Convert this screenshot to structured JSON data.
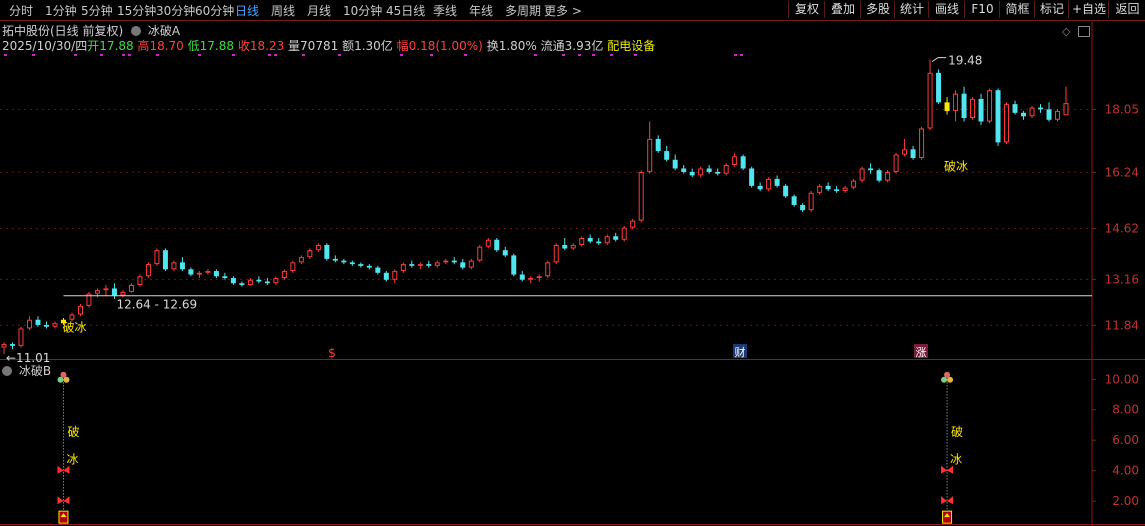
{
  "toolbar": {
    "timeframes": [
      "分时",
      "1分钟",
      "5分钟",
      "15分钟",
      "30分钟",
      "60分钟",
      "日线",
      "周线",
      "月线",
      "10分钟",
      "45日线",
      "季线",
      "年线",
      "多周期",
      "更多 >"
    ],
    "active": "日线",
    "right_buttons": [
      "复权",
      "叠加",
      "多股",
      "统计",
      "画线",
      "F10",
      "简框",
      "标记",
      "+自选",
      "返回"
    ]
  },
  "stock": {
    "name_line": "拓中股份(日线 前复权)",
    "indicator_main": "冰破A",
    "date": "2025/10/30/四",
    "open_label": "开",
    "open": "17.88",
    "high_label": "高",
    "high": "18.70",
    "low_label": "低",
    "low": "17.88",
    "close_label": "收",
    "close": "18.23",
    "vol_label": "量",
    "vol": "70781",
    "amt_label": "额",
    "amt": "1.30亿",
    "chg_label": "幅",
    "chg": "0.18(1.00%)",
    "turnover_label": "换",
    "turnover": "1.80%",
    "float_label": "流通",
    "float": "3.93亿",
    "sector": "配电设备"
  },
  "main_chart": {
    "y_ticks": [
      "18.05",
      "16.24",
      "14.62",
      "13.16",
      "11.84"
    ],
    "annotations": {
      "max_label": "19.48",
      "min_label": "11.01",
      "support_label": "12.64 - 12.69",
      "signal_text_1": "破冰",
      "signal_text_2": "破冰"
    },
    "markers": {
      "s": "$",
      "cai": "财",
      "zhang": "涨"
    },
    "colors": {
      "up": "#ff3a3a",
      "down": "#50e6f0",
      "signal": "#ffe800",
      "dots": "#d020d0"
    }
  },
  "sub_chart": {
    "title": "冰破B",
    "y_ticks": [
      "10.00",
      "8.00",
      "6.00",
      "4.00",
      "2.00"
    ],
    "text_po": "破",
    "text_bing": "冰"
  },
  "chart_data": {
    "type": "candlestick",
    "candles": [
      [
        11.2,
        11.35,
        11.01,
        11.3
      ],
      [
        11.3,
        11.35,
        11.15,
        11.25
      ],
      [
        11.25,
        11.8,
        11.2,
        11.75
      ],
      [
        11.75,
        12.1,
        11.7,
        12.0
      ],
      [
        12.0,
        12.1,
        11.8,
        11.85
      ],
      [
        11.85,
        11.95,
        11.75,
        11.8
      ],
      [
        11.8,
        11.95,
        11.75,
        11.9
      ],
      [
        11.9,
        12.05,
        11.85,
        12.0
      ],
      [
        12.0,
        12.2,
        11.95,
        12.15
      ],
      [
        12.15,
        12.45,
        12.1,
        12.4
      ],
      [
        12.4,
        12.8,
        12.35,
        12.75
      ],
      [
        12.75,
        12.9,
        12.65,
        12.85
      ],
      [
        12.85,
        13.0,
        12.7,
        12.9
      ],
      [
        12.9,
        13.05,
        12.6,
        12.7
      ],
      [
        12.7,
        12.85,
        12.64,
        12.8
      ],
      [
        12.8,
        13.05,
        12.78,
        13.0
      ],
      [
        13.0,
        13.3,
        12.95,
        13.25
      ],
      [
        13.25,
        13.65,
        13.2,
        13.6
      ],
      [
        13.6,
        14.05,
        13.55,
        14.0
      ],
      [
        14.0,
        14.05,
        13.4,
        13.45
      ],
      [
        13.45,
        13.7,
        13.4,
        13.65
      ],
      [
        13.65,
        13.8,
        13.4,
        13.45
      ],
      [
        13.45,
        13.5,
        13.25,
        13.3
      ],
      [
        13.3,
        13.4,
        13.2,
        13.35
      ],
      [
        13.35,
        13.45,
        13.3,
        13.4
      ],
      [
        13.4,
        13.45,
        13.2,
        13.25
      ],
      [
        13.25,
        13.35,
        13.15,
        13.2
      ],
      [
        13.2,
        13.25,
        13.0,
        13.05
      ],
      [
        13.05,
        13.1,
        12.95,
        13.0
      ],
      [
        13.0,
        13.2,
        12.98,
        13.15
      ],
      [
        13.15,
        13.25,
        13.05,
        13.1
      ],
      [
        13.1,
        13.2,
        13.0,
        13.05
      ],
      [
        13.05,
        13.25,
        13.0,
        13.2
      ],
      [
        13.2,
        13.45,
        13.15,
        13.4
      ],
      [
        13.4,
        13.7,
        13.35,
        13.65
      ],
      [
        13.65,
        13.85,
        13.6,
        13.8
      ],
      [
        13.8,
        14.05,
        13.75,
        14.0
      ],
      [
        14.0,
        14.2,
        13.95,
        14.15
      ],
      [
        14.15,
        14.2,
        13.7,
        13.75
      ],
      [
        13.75,
        13.85,
        13.65,
        13.7
      ],
      [
        13.7,
        13.75,
        13.6,
        13.65
      ],
      [
        13.65,
        13.7,
        13.55,
        13.6
      ],
      [
        13.6,
        13.65,
        13.5,
        13.55
      ],
      [
        13.55,
        13.6,
        13.45,
        13.5
      ],
      [
        13.5,
        13.55,
        13.3,
        13.35
      ],
      [
        13.35,
        13.4,
        13.1,
        13.15
      ],
      [
        13.15,
        13.45,
        13.05,
        13.4
      ],
      [
        13.4,
        13.65,
        13.35,
        13.6
      ],
      [
        13.6,
        13.7,
        13.5,
        13.55
      ],
      [
        13.55,
        13.65,
        13.45,
        13.6
      ],
      [
        13.6,
        13.7,
        13.5,
        13.55
      ],
      [
        13.55,
        13.7,
        13.5,
        13.65
      ],
      [
        13.65,
        13.75,
        13.6,
        13.7
      ],
      [
        13.7,
        13.8,
        13.6,
        13.65
      ],
      [
        13.65,
        13.75,
        13.45,
        13.5
      ],
      [
        13.5,
        13.75,
        13.45,
        13.7
      ],
      [
        13.7,
        14.15,
        13.65,
        14.1
      ],
      [
        14.1,
        14.35,
        14.05,
        14.3
      ],
      [
        14.3,
        14.35,
        13.95,
        14.0
      ],
      [
        14.0,
        14.1,
        13.8,
        13.85
      ],
      [
        13.85,
        13.9,
        13.25,
        13.3
      ],
      [
        13.3,
        13.4,
        13.1,
        13.15
      ],
      [
        13.15,
        13.25,
        13.05,
        13.2
      ],
      [
        13.2,
        13.3,
        13.1,
        13.25
      ],
      [
        13.25,
        13.7,
        13.2,
        13.65
      ],
      [
        13.65,
        14.2,
        13.6,
        14.15
      ],
      [
        14.15,
        14.35,
        14.0,
        14.05
      ],
      [
        14.05,
        14.2,
        14.0,
        14.15
      ],
      [
        14.15,
        14.4,
        14.1,
        14.35
      ],
      [
        14.35,
        14.45,
        14.2,
        14.25
      ],
      [
        14.25,
        14.35,
        14.15,
        14.2
      ],
      [
        14.2,
        14.45,
        14.15,
        14.4
      ],
      [
        14.4,
        14.5,
        14.25,
        14.3
      ],
      [
        14.3,
        14.7,
        14.25,
        14.65
      ],
      [
        14.65,
        14.9,
        14.6,
        14.85
      ],
      [
        14.85,
        16.3,
        14.8,
        16.25
      ],
      [
        16.25,
        17.7,
        16.2,
        17.2
      ],
      [
        17.2,
        17.3,
        16.8,
        16.85
      ],
      [
        16.85,
        17.0,
        16.55,
        16.6
      ],
      [
        16.6,
        16.75,
        16.3,
        16.35
      ],
      [
        16.35,
        16.45,
        16.2,
        16.25
      ],
      [
        16.25,
        16.35,
        16.1,
        16.15
      ],
      [
        16.15,
        16.4,
        16.1,
        16.35
      ],
      [
        16.35,
        16.45,
        16.2,
        16.25
      ],
      [
        16.25,
        16.35,
        16.15,
        16.2
      ],
      [
        16.2,
        16.5,
        16.15,
        16.45
      ],
      [
        16.45,
        16.8,
        16.4,
        16.7
      ],
      [
        16.7,
        16.75,
        16.3,
        16.35
      ],
      [
        16.35,
        16.4,
        15.8,
        15.85
      ],
      [
        15.85,
        15.95,
        15.7,
        15.75
      ],
      [
        15.75,
        16.1,
        15.7,
        16.05
      ],
      [
        16.05,
        16.15,
        15.8,
        15.85
      ],
      [
        15.85,
        15.9,
        15.5,
        15.55
      ],
      [
        15.55,
        15.6,
        15.25,
        15.3
      ],
      [
        15.3,
        15.35,
        15.1,
        15.15
      ],
      [
        15.15,
        15.7,
        15.1,
        15.65
      ],
      [
        15.65,
        15.9,
        15.6,
        15.85
      ],
      [
        15.85,
        15.95,
        15.7,
        15.75
      ],
      [
        15.75,
        15.85,
        15.65,
        15.7
      ],
      [
        15.7,
        15.85,
        15.65,
        15.8
      ],
      [
        15.8,
        16.05,
        15.75,
        16.0
      ],
      [
        16.0,
        16.4,
        15.95,
        16.35
      ],
      [
        16.35,
        16.5,
        16.2,
        16.3
      ],
      [
        16.3,
        16.35,
        15.95,
        16.0
      ],
      [
        16.0,
        16.3,
        15.95,
        16.25
      ],
      [
        16.25,
        16.8,
        16.2,
        16.75
      ],
      [
        16.75,
        17.2,
        16.7,
        16.9
      ],
      [
        16.9,
        17.0,
        16.6,
        16.65
      ],
      [
        16.65,
        17.55,
        16.6,
        17.5
      ],
      [
        17.5,
        19.48,
        17.45,
        19.1
      ],
      [
        19.1,
        19.2,
        18.2,
        18.25
      ],
      [
        18.25,
        18.4,
        17.9,
        18.0
      ],
      [
        18.0,
        18.6,
        17.7,
        18.5
      ],
      [
        18.5,
        18.7,
        17.7,
        17.8
      ],
      [
        17.8,
        18.4,
        17.75,
        18.35
      ],
      [
        18.35,
        18.5,
        17.6,
        17.7
      ],
      [
        17.7,
        18.65,
        17.65,
        18.6
      ],
      [
        18.6,
        18.65,
        17.0,
        17.1
      ],
      [
        17.1,
        18.25,
        17.05,
        18.2
      ],
      [
        18.2,
        18.3,
        17.9,
        17.95
      ],
      [
        17.95,
        18.0,
        17.75,
        17.85
      ],
      [
        17.85,
        18.15,
        17.8,
        18.1
      ],
      [
        18.1,
        18.2,
        17.95,
        18.05
      ],
      [
        18.05,
        18.25,
        17.7,
        17.75
      ],
      [
        17.75,
        18.05,
        17.7,
        18.0
      ],
      [
        17.88,
        18.7,
        17.88,
        18.23
      ]
    ],
    "ylim": [
      10.9,
      19.9
    ]
  }
}
